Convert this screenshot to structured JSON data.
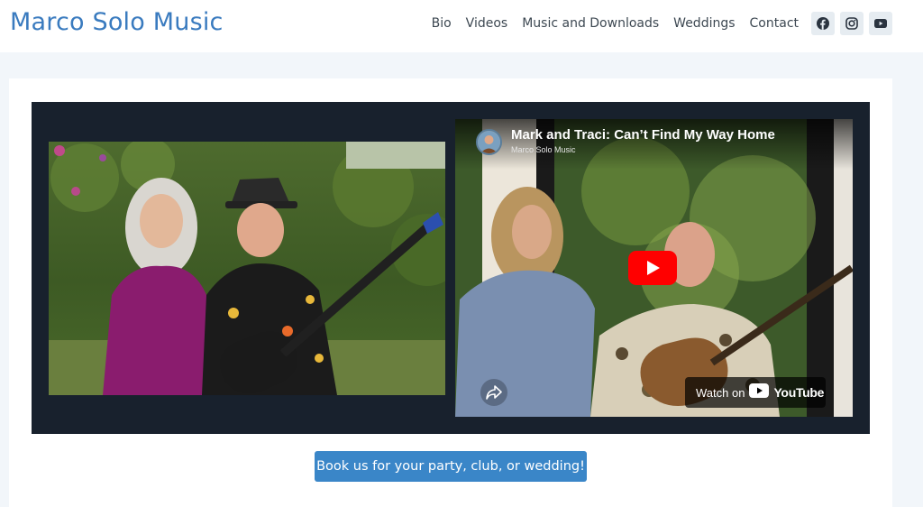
{
  "site": {
    "title": "Marco Solo Music"
  },
  "nav": {
    "items": [
      {
        "label": "Bio"
      },
      {
        "label": "Videos"
      },
      {
        "label": "Music and Downloads"
      },
      {
        "label": "Weddings"
      },
      {
        "label": "Contact"
      }
    ]
  },
  "social": {
    "icons": [
      "facebook-icon",
      "instagram-icon",
      "youtube-icon"
    ]
  },
  "video": {
    "title": "Mark and Traci: Can’t Find My Way Home",
    "channel": "Marco Solo Music",
    "watch_on_label": "Watch on",
    "youtube_wordmark": "YouTube"
  },
  "cta": {
    "label": "Book us for your party, club, or wedding!"
  },
  "colors": {
    "brand": "#3a7bbf",
    "button": "#3a86c8",
    "media_bg": "#18212d",
    "page_bg": "#f2f6fa",
    "youtube_red": "#ff0000"
  }
}
